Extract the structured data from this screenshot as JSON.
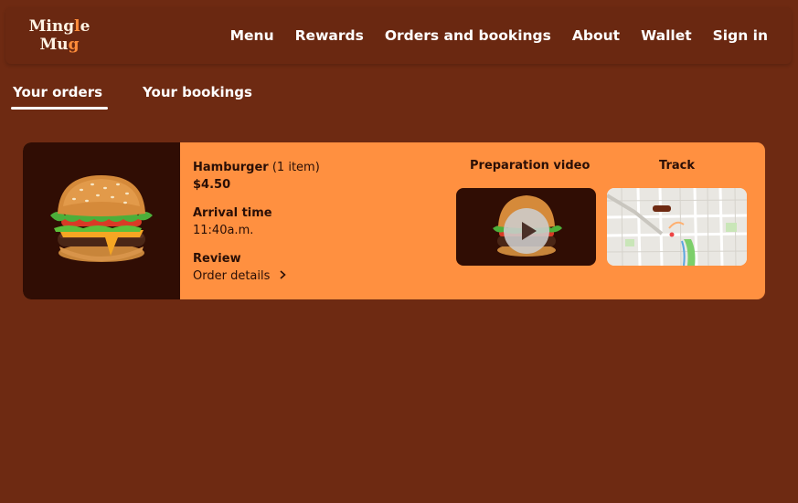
{
  "brand": {
    "logo_line1_start": "Ming",
    "logo_line1_accent": "l",
    "logo_line1_end": "e",
    "logo_line2_start": "Mu",
    "logo_line2_accent": "g"
  },
  "nav": {
    "items": [
      "Menu",
      "Rewards",
      "Orders and bookings",
      "About",
      "Wallet",
      "Sign in"
    ]
  },
  "tabs": [
    {
      "label": "Your orders",
      "active": true
    },
    {
      "label": "Your bookings",
      "active": false
    }
  ],
  "order": {
    "item_name": "Hamburger",
    "item_count": "(1 item)",
    "price": "$4.50",
    "arrival_label": "Arrival time",
    "arrival_time": "11:40a.m.",
    "review_label": "Review",
    "details_link": "Order details",
    "preparation_video_label": "Preparation video",
    "track_label": "Track"
  },
  "colors": {
    "background": "#6e2a12",
    "card": "#ff9040",
    "image_bg": "#300d04",
    "accent": "#ff8c3a"
  },
  "icons": {
    "chevron": "chevron-right-icon",
    "play": "play-icon"
  }
}
